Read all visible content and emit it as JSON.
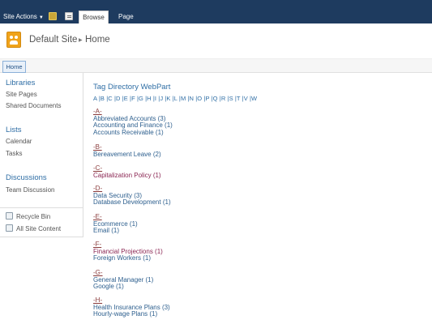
{
  "ribbon": {
    "site_actions": "Site Actions",
    "tabs": [
      {
        "label": "Browse",
        "selected": true
      },
      {
        "label": "Page",
        "selected": false
      }
    ]
  },
  "header": {
    "site_title": "Default Site",
    "page_title": "Home"
  },
  "topnav": {
    "home": "Home"
  },
  "quicklaunch": {
    "libraries": {
      "heading": "Libraries",
      "items": [
        "Site Pages",
        "Shared Documents"
      ]
    },
    "lists": {
      "heading": "Lists",
      "items": [
        "Calendar",
        "Tasks"
      ]
    },
    "discussions": {
      "heading": "Discussions",
      "items": [
        "Team Discussion"
      ]
    },
    "utility": {
      "recycle_bin": "Recycle Bin",
      "all_site_content": "All Site Content"
    }
  },
  "webpart": {
    "title": "Tag Directory WebPart",
    "alphabet": "A |B |C |D |E |F |G |H |I |J |K |L |M |N |O |P |Q |R |S |T |V |W",
    "groups": [
      {
        "letter": "-A-",
        "tags": [
          "Abbreviated Accounts (3)",
          "Accounting and Finance (1)",
          "Accounts Receivable (1)"
        ]
      },
      {
        "letter": "-B-",
        "tags": [
          "Bereavement Leave (2)"
        ]
      },
      {
        "letter": "-C-",
        "tags": [
          "Capitalization Policy (1)"
        ]
      },
      {
        "letter": "-D-",
        "tags": [
          "Data Security (3)",
          "Database Development (1)"
        ]
      },
      {
        "letter": "-E-",
        "tags": [
          "Ecommerce (1)",
          "Email (1)"
        ]
      },
      {
        "letter": "-F-",
        "tags": [
          "Financial Projections (1)",
          "Foreign Workers (1)"
        ]
      },
      {
        "letter": "-G-",
        "tags": [
          "General Manager (1)",
          "Google (1)"
        ]
      },
      {
        "letter": "-H-",
        "tags": [
          "Health Insurance Plans (3)",
          "Hourly-wage Plans (1)"
        ]
      }
    ]
  },
  "colors": {
    "ribbon_bg": "#1e3b5f",
    "link": "#2d5f8e",
    "visited_link": "#8a2552",
    "heading": "#2f6ea5"
  }
}
